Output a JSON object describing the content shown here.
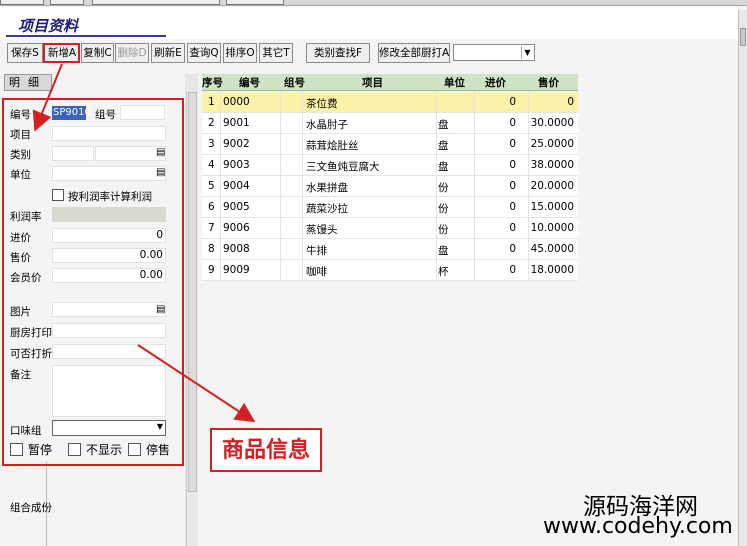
{
  "window": {
    "title": "项目资料"
  },
  "toolbar": {
    "save": "保存S",
    "new": "新增A",
    "copy": "复制C",
    "delete": "删除D",
    "refresh": "刷新E",
    "query": "查询Q",
    "sort": "排序O",
    "other": "其它T",
    "category_find": "类别查找F",
    "kitchen_print_all": "修改全部厨打A",
    "kitchen_select_value": ""
  },
  "left_panel": {
    "tab_label": "明细",
    "fields": {
      "code_label": "编号",
      "code_value": "SP9010",
      "group_label": "组号",
      "group_value": "",
      "item_label": "项目",
      "category_label": "类别",
      "unit_label": "单位",
      "by_margin_label": "按利润率计算利润",
      "margin_label": "利润率",
      "cost_label": "进价",
      "cost_value": "0",
      "price_label": "售价",
      "price_value": "0.00",
      "member_price_label": "会员价",
      "member_price_value": "0.00",
      "image_label": "图片",
      "kitchen_print_label": "厨房打印",
      "discountable_label": "可否打折",
      "remark_label": "备注",
      "flavor_group_label": "口味组",
      "pause_label": "暂停",
      "hide_label": "不显示",
      "stop_sale_label": "停售",
      "combo_cost_label": "组合成份"
    }
  },
  "grid": {
    "headers": {
      "seq": "序号",
      "code": "编号",
      "group": "组号",
      "item": "项目",
      "unit": "单位",
      "cost": "进价",
      "price": "售价"
    },
    "rows": [
      {
        "seq": "1",
        "code": "0000",
        "group": "",
        "item": "茶位费",
        "unit": "",
        "cost": "0",
        "price": "0"
      },
      {
        "seq": "2",
        "code": "9001",
        "group": "",
        "item": "水晶肘子",
        "unit": "盘",
        "cost": "0",
        "price": "30.0000"
      },
      {
        "seq": "3",
        "code": "9002",
        "group": "",
        "item": "蒜茸烩肚丝",
        "unit": "盘",
        "cost": "0",
        "price": "25.0000"
      },
      {
        "seq": "4",
        "code": "9003",
        "group": "",
        "item": "三文鱼炖豆腐大",
        "unit": "盘",
        "cost": "0",
        "price": "38.0000"
      },
      {
        "seq": "5",
        "code": "9004",
        "group": "",
        "item": "水果拼盘",
        "unit": "份",
        "cost": "0",
        "price": "20.0000"
      },
      {
        "seq": "6",
        "code": "9005",
        "group": "",
        "item": "蔬菜沙拉",
        "unit": "份",
        "cost": "0",
        "price": "15.0000"
      },
      {
        "seq": "7",
        "code": "9006",
        "group": "",
        "item": "蒸馒头",
        "unit": "份",
        "cost": "0",
        "price": "10.0000"
      },
      {
        "seq": "8",
        "code": "9008",
        "group": "",
        "item": "牛排",
        "unit": "盘",
        "cost": "0",
        "price": "45.0000"
      },
      {
        "seq": "9",
        "code": "9009",
        "group": "",
        "item": "咖啡",
        "unit": "杯",
        "cost": "0",
        "price": "18.0000"
      }
    ]
  },
  "annotation": {
    "text": "商品信息"
  },
  "watermark": {
    "line1": "源码海洋网",
    "line2": "www.codehy.com"
  },
  "colors": {
    "annotation_red": "#d42020",
    "selected_row": "#fbf2a8",
    "grid_header": "#cfe3c6",
    "selected_value": "#3a62c0"
  }
}
